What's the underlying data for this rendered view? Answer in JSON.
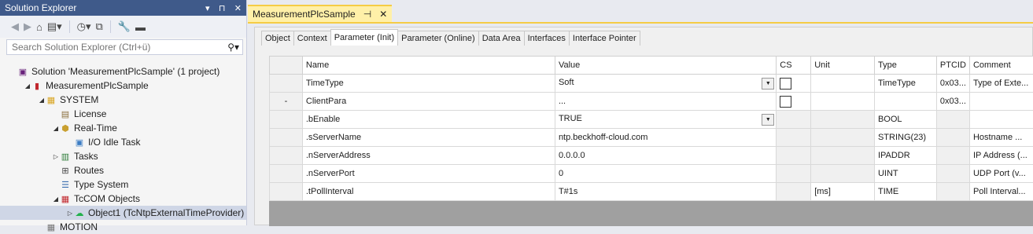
{
  "solution_explorer": {
    "title": "Solution Explorer",
    "title_buttons": [
      "▾",
      "⊓",
      "✕"
    ],
    "search_placeholder": "Search Solution Explorer (Ctrl+ü)",
    "tree": [
      {
        "label": "Solution 'MeasurementPlcSample' (1 project)",
        "icon": "solution-icon",
        "indent": 0,
        "expander": ""
      },
      {
        "label": "MeasurementPlcSample",
        "icon": "project-icon",
        "indent": 1,
        "expander": "◢"
      },
      {
        "label": "SYSTEM",
        "icon": "system-icon",
        "indent": 2,
        "expander": "◢"
      },
      {
        "label": "License",
        "icon": "license-icon",
        "indent": 3,
        "expander": ""
      },
      {
        "label": "Real-Time",
        "icon": "realtime-icon",
        "indent": 3,
        "expander": "◢"
      },
      {
        "label": "I/O Idle Task",
        "icon": "task-icon",
        "indent": 4,
        "expander": ""
      },
      {
        "label": "Tasks",
        "icon": "tasks-icon",
        "indent": 3,
        "expander": "▷"
      },
      {
        "label": "Routes",
        "icon": "routes-icon",
        "indent": 3,
        "expander": ""
      },
      {
        "label": "Type System",
        "icon": "type-system-icon",
        "indent": 3,
        "expander": ""
      },
      {
        "label": "TcCOM Objects",
        "icon": "tccom-icon",
        "indent": 3,
        "expander": "◢"
      },
      {
        "label": "Object1 (TcNtpExternalTimeProvider)",
        "icon": "object-cloud-icon",
        "indent": 4,
        "expander": "▷",
        "selected": true
      },
      {
        "label": "MOTION",
        "icon": "motion-icon",
        "indent": 2,
        "expander": ""
      }
    ]
  },
  "editor": {
    "doc_tab": "MeasurementPlcSample",
    "doc_tab_pin": "⊣",
    "doc_tab_close": "✕",
    "sub_tabs": [
      "Object",
      "Context",
      "Parameter (Init)",
      "Parameter (Online)",
      "Data Area",
      "Interfaces",
      "Interface Pointer"
    ],
    "active_sub_tab": "Parameter (Init)",
    "columns": [
      "",
      "Name",
      "Value",
      "CS",
      "Unit",
      "Type",
      "PTCID",
      "Comment"
    ],
    "rows": [
      {
        "mark": "",
        "name": "TimeType",
        "value": "Soft",
        "dropdown": true,
        "cs": true,
        "unit": "",
        "type": "TimeType",
        "ptcid": "0x03...",
        "comment": "Type of Exte..."
      },
      {
        "mark": "-",
        "name": "ClientPara",
        "value": "...",
        "dropdown": false,
        "cs": true,
        "unit": "",
        "type": "",
        "ptcid": "0x03...",
        "comment": ""
      },
      {
        "mark": "",
        "name": ".bEnable",
        "value": "TRUE",
        "dropdown": true,
        "cs": false,
        "unit": "",
        "type": "BOOL",
        "ptcid": "",
        "comment": ""
      },
      {
        "mark": "",
        "name": ".sServerName",
        "value": "ntp.beckhoff-cloud.com",
        "dropdown": false,
        "cs": false,
        "unit": "",
        "type": "STRING(23)",
        "ptcid": "",
        "comment": "Hostname ..."
      },
      {
        "mark": "",
        "name": ".nServerAddress",
        "value": "0.0.0.0",
        "dropdown": false,
        "cs": false,
        "unit": "",
        "type": "IPADDR",
        "ptcid": "",
        "comment": "IP Address (..."
      },
      {
        "mark": "",
        "name": ".nServerPort",
        "value": "0",
        "dropdown": false,
        "cs": false,
        "unit": "",
        "type": "UINT",
        "ptcid": "",
        "comment": "UDP Port (v..."
      },
      {
        "mark": "",
        "name": ".tPollInterval",
        "value": "T#1s",
        "dropdown": false,
        "cs": false,
        "unit": "[ms]",
        "type": "TIME",
        "ptcid": "",
        "comment": "Poll Interval..."
      }
    ]
  }
}
